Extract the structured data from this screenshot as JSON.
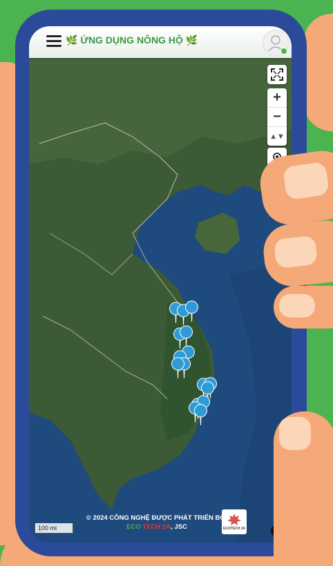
{
  "header": {
    "title_prefix_icon": "leaf-icon",
    "title": "ỨNG DỤNG NÔNG HỘ",
    "title_suffix_icon": "leaf-icon",
    "menu_icon": "hamburger-menu-icon",
    "avatar_icon": "user-avatar-icon",
    "online_status_color": "#3fbf3f"
  },
  "map_controls": {
    "fullscreen_icon": "fullscreen-icon",
    "zoom_in": "+",
    "zoom_out": "−",
    "compass": "▲▼",
    "locate_icon": "locate-icon"
  },
  "map": {
    "scale_label": "100 mi",
    "marker_color": "#2f9bd6",
    "marker_count": 16
  },
  "footer": {
    "line1": "© 2024 CÔNG NGHỆ ĐƯỢC PHÁT TRIỂN BỞI",
    "brand_part1": "ECO",
    "brand_part2": "TECH 2A",
    "brand_suffix": ", JSC",
    "logo_text": "ECOTECH 2A",
    "info_icon": "info-icon",
    "info_label": "i"
  },
  "colors": {
    "background": "#4bb34f",
    "phone_frame": "#2b4a9a",
    "title_green": "#3b9a44"
  }
}
